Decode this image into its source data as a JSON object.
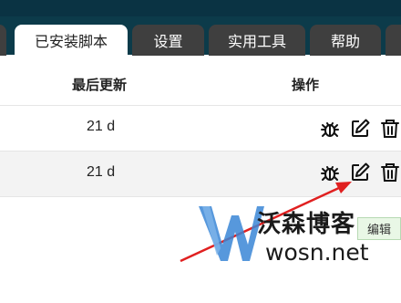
{
  "tabs": [
    {
      "label": "已安装脚本",
      "active": true
    },
    {
      "label": "设置",
      "active": false
    },
    {
      "label": "实用工具",
      "active": false
    },
    {
      "label": "帮助",
      "active": false
    }
  ],
  "table": {
    "headers": [
      "最后更新",
      "操作"
    ],
    "rows": [
      {
        "last_updated": "21 d",
        "actions": [
          "bug-icon",
          "edit-icon",
          "trash-icon"
        ]
      },
      {
        "last_updated": "21 d",
        "actions": [
          "bug-icon",
          "edit-icon",
          "trash-icon"
        ]
      }
    ]
  },
  "tooltip": {
    "text": "编辑"
  },
  "watermark": {
    "cn": "沃森博客",
    "url": "wosn.net"
  },
  "colors": {
    "topbar": "#0c3b4a",
    "tab_inactive": "#3f3f3f",
    "arrow": "#e02020",
    "tooltip_bg": "#e9f7e6",
    "logo_blue": "#3a86d6"
  }
}
